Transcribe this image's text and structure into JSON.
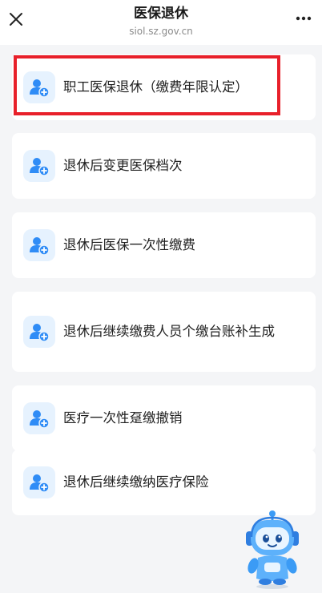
{
  "header": {
    "title": "医保退休",
    "subtitle": "siol.sz.gov.cn",
    "close_icon": "close-icon",
    "more_icon": "more-dots-icon"
  },
  "menu": [
    {
      "label": "职工医保退休（缴费年限认定）",
      "icon": "user-add-icon"
    },
    {
      "label": "退休后变更医保档次",
      "icon": "user-add-icon"
    },
    {
      "label": "退休后医保一次性缴费",
      "icon": "user-add-icon"
    },
    {
      "label": "退休后继续缴费人员个缴台账补生成",
      "icon": "user-add-icon"
    },
    {
      "label": "医疗一次性趸缴撤销",
      "icon": "user-add-icon"
    },
    {
      "label": "退休后继续缴纳医疗保险",
      "icon": "user-add-icon"
    }
  ],
  "assistant": {
    "icon": "robot-assistant-icon"
  },
  "colors": {
    "accent": "#2f8cf6",
    "icon_bg": "#e6f2fe",
    "highlight": "#e8202a"
  }
}
